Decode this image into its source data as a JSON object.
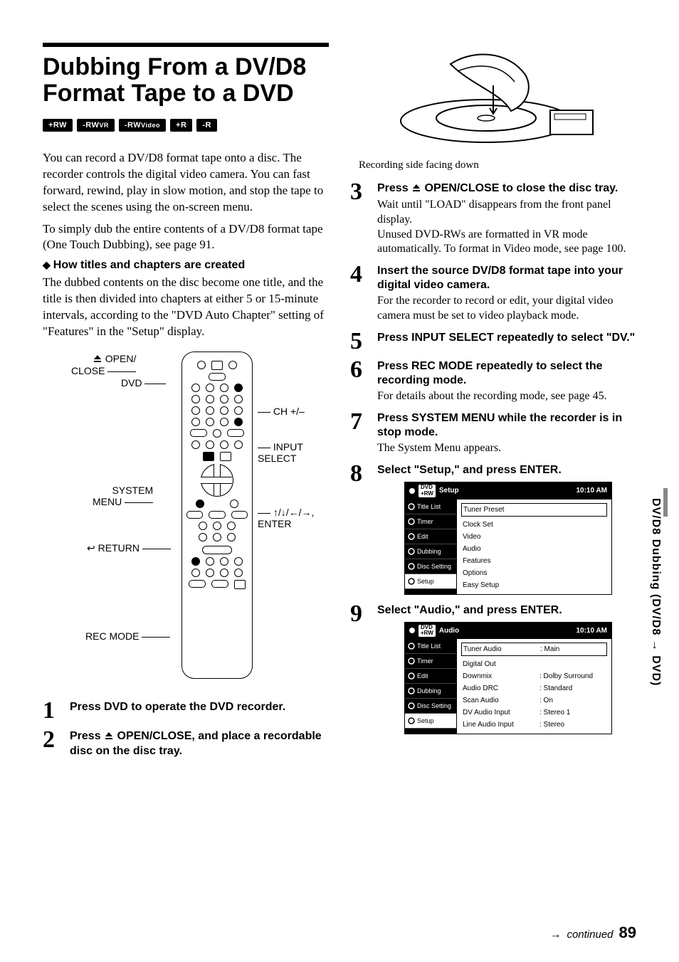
{
  "title": "Dubbing From a DV/D8 Format Tape to a DVD",
  "badges": [
    "+RW",
    "-RWVR",
    "-RWVideo",
    "+R",
    "-R"
  ],
  "intro1": "You can record a DV/D8 format tape onto a disc. The recorder controls the digital video camera. You can fast forward, rewind, play in slow motion, and stop the tape to select the scenes using the on-screen menu.",
  "intro2": "To simply dub the entire contents of a DV/D8 format tape (One Touch Dubbing), see page 91.",
  "sub1": "How titles and chapters are created",
  "sub1_body": "The dubbed contents on the disc become one title, and the title is then divided into chapters at either 5 or 15-minute intervals, according to the \"DVD Auto Chapter\" setting of \"Features\" in the \"Setup\" display.",
  "remote_labels": {
    "open_close": "OPEN/\nCLOSE",
    "dvd": "DVD",
    "ch": "CH +/–",
    "input_select": "INPUT\nSELECT",
    "system_menu": "SYSTEM\nMENU",
    "arrows_enter": "↑/↓/←/→,\nENTER",
    "return": "RETURN",
    "rec_mode": "REC MODE"
  },
  "illus_caption": "Recording side facing down",
  "steps": [
    {
      "n": "1",
      "head": "Press DVD to operate the DVD recorder.",
      "body": ""
    },
    {
      "n": "2",
      "head": "Press ⏏ OPEN/CLOSE, and place a recordable disc on the disc tray.",
      "body": ""
    },
    {
      "n": "3",
      "head": "Press ⏏ OPEN/CLOSE to close the disc tray.",
      "body": "Wait until \"LOAD\" disappears from the front panel display.\nUnused DVD-RWs are formatted in VR mode automatically. To format in Video mode, see page 100."
    },
    {
      "n": "4",
      "head": "Insert the source DV/D8 format tape into your digital video camera.",
      "body": "For the recorder to record or edit, your digital video camera must be set to video playback mode."
    },
    {
      "n": "5",
      "head": "Press INPUT SELECT repeatedly to select \"DV.\"",
      "body": ""
    },
    {
      "n": "6",
      "head": "Press REC MODE repeatedly to select the recording mode.",
      "body": "For details about the recording mode, see page 45."
    },
    {
      "n": "7",
      "head": "Press SYSTEM MENU while the recorder is in stop mode.",
      "body": "The System Menu appears."
    },
    {
      "n": "8",
      "head": "Select \"Setup,\" and press ENTER.",
      "body": ""
    },
    {
      "n": "9",
      "head": "Select \"Audio,\" and press ENTER.",
      "body": ""
    }
  ],
  "menu_setup": {
    "title": "Setup",
    "time": "10:10 AM",
    "side": [
      "Title List",
      "Timer",
      "Edit",
      "Dubbing",
      "Disc Setting",
      "Setup"
    ],
    "side_selected_index": 5,
    "main_boxed": "Tuner Preset",
    "main": [
      "Clock Set",
      "Video",
      "Audio",
      "Features",
      "Options",
      "Easy Setup"
    ]
  },
  "menu_audio": {
    "title": "Audio",
    "time": "10:10 AM",
    "side": [
      "Title List",
      "Timer",
      "Edit",
      "Dubbing",
      "Disc Setting",
      "Setup"
    ],
    "side_selected_index": 5,
    "rows": [
      {
        "k": "Tuner Audio",
        "v": ": Main",
        "boxed": true
      },
      {
        "k": "Digital Out",
        "v": ""
      },
      {
        "k": "Downmix",
        "v": ": Dolby Surround"
      },
      {
        "k": "Audio DRC",
        "v": ": Standard"
      },
      {
        "k": "Scan Audio",
        "v": ": On"
      },
      {
        "k": "DV Audio Input",
        "v": ": Stereo 1"
      },
      {
        "k": "Line Audio Input",
        "v": ": Stereo"
      }
    ]
  },
  "sidetab": "DV/D8 Dubbing (DV/D8 → DVD)",
  "footer": {
    "arrow": "→",
    "continued": "continued",
    "page": "89"
  }
}
